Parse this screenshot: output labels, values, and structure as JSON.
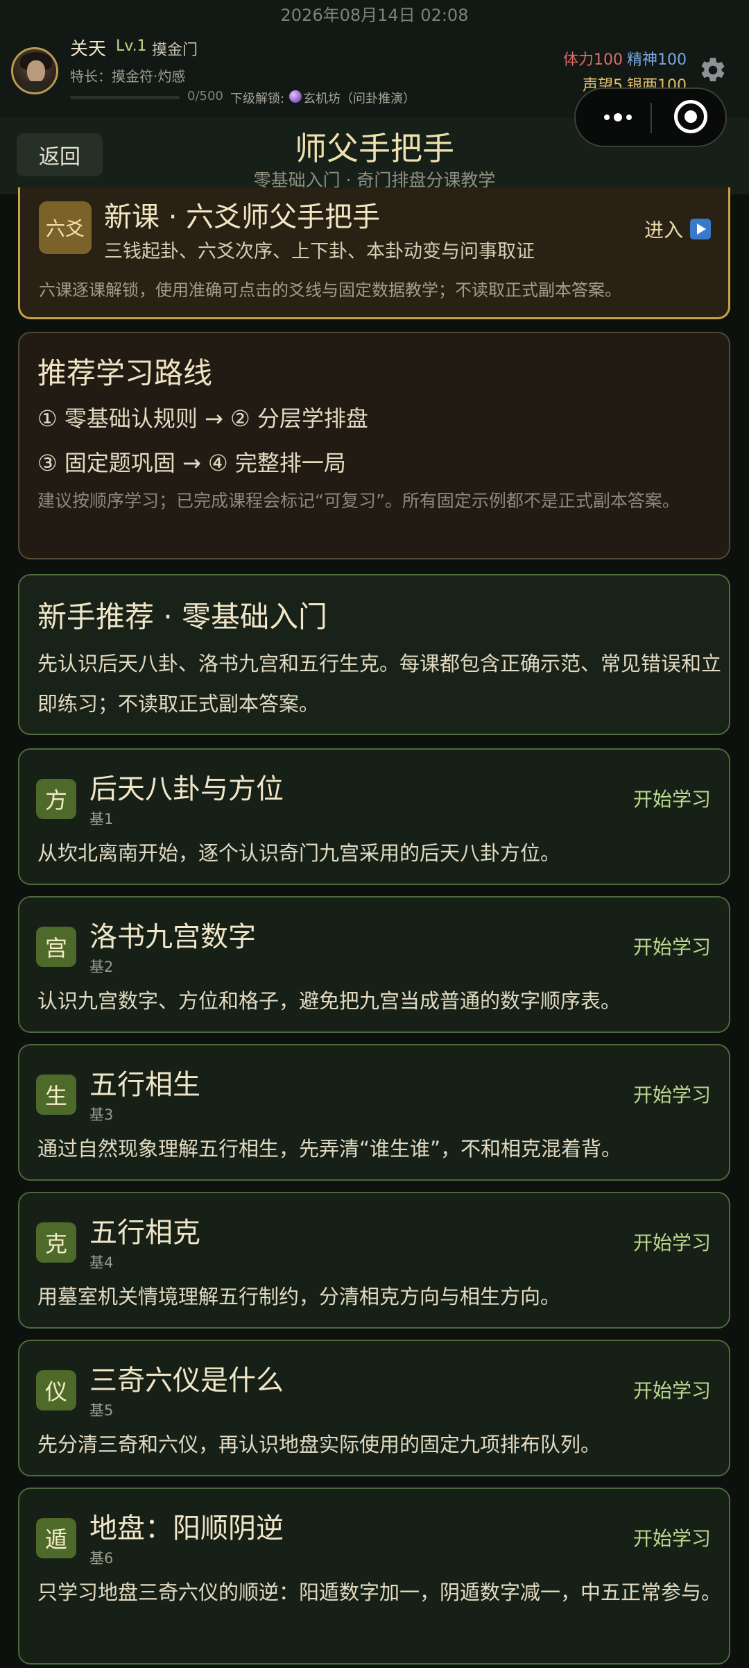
{
  "status_bar": {
    "datetime": "2026年08月14日 02:08"
  },
  "player": {
    "name": "关天",
    "level": "Lv.1",
    "sect": "摸金门",
    "skill": "特长：摸金符·灼感",
    "xp_progress": 0,
    "xp_text": "0/500",
    "unlock_label": "下级解锁:",
    "unlock_target": "玄机坊（问卦推演）",
    "stats": {
      "hp": "体力100",
      "spirit": "精神100",
      "reputation": "声望5",
      "silver": "银两100"
    }
  },
  "mini_program_capsule": {
    "more_icon": "more-dots-icon",
    "close_icon": "close-ring-icon"
  },
  "nav": {
    "back_label": "返回",
    "title": "师父手把手",
    "subtitle": "零基础入门 · 奇门排盘分课教学"
  },
  "featured_course": {
    "badge": "六爻",
    "title": "新课 · 六爻师父手把手",
    "subtitle": "三钱起卦、六爻次序、上下卦、本卦动变与问事取证",
    "description": "六课逐课解锁，使用准确可点击的爻线与固定数据教学；不读取正式副本答案。",
    "enter_label": "进入"
  },
  "learning_route": {
    "title": "推荐学习路线",
    "line1": "① 零基础认规则 → ② 分层学排盘",
    "line2": "③ 固定题巩固 → ④ 完整排一局",
    "note": "建议按顺序学习；已完成课程会标记“可复习”。所有固定示例都不是正式副本答案。"
  },
  "beginner_intro": {
    "title": "新手推荐 · 零基础入门",
    "body": "先认识后天八卦、洛书九宫和五行生克。每课都包含正确示范、常见错误和立即练习；不读取正式副本答案。"
  },
  "lessons": [
    {
      "badge": "方",
      "title": "后天八卦与方位",
      "code": "基1",
      "action": "开始学习",
      "desc": "从坎北离南开始，逐个认识奇门九宫采用的后天八卦方位。"
    },
    {
      "badge": "宫",
      "title": "洛书九宫数字",
      "code": "基2",
      "action": "开始学习",
      "desc": "认识九宫数字、方位和格子，避免把九宫当成普通的数字顺序表。"
    },
    {
      "badge": "生",
      "title": "五行相生",
      "code": "基3",
      "action": "开始学习",
      "desc": "通过自然现象理解五行相生，先弄清“谁生谁”，不和相克混着背。"
    },
    {
      "badge": "克",
      "title": "五行相克",
      "code": "基4",
      "action": "开始学习",
      "desc": "用墓室机关情境理解五行制约，分清相克方向与相生方向。"
    },
    {
      "badge": "仪",
      "title": "三奇六仪是什么",
      "code": "基5",
      "action": "开始学习",
      "desc": "先分清三奇和六仪，再认识地盘实际使用的固定九项排布队列。"
    },
    {
      "badge": "遁",
      "title": "地盘：阳顺阴逆",
      "code": "基6",
      "action": "开始学习",
      "desc": "只学习地盘三奇六仪的顺逆：阳遁数字加一，阴遁数字减一，中五正常参与。"
    }
  ]
}
